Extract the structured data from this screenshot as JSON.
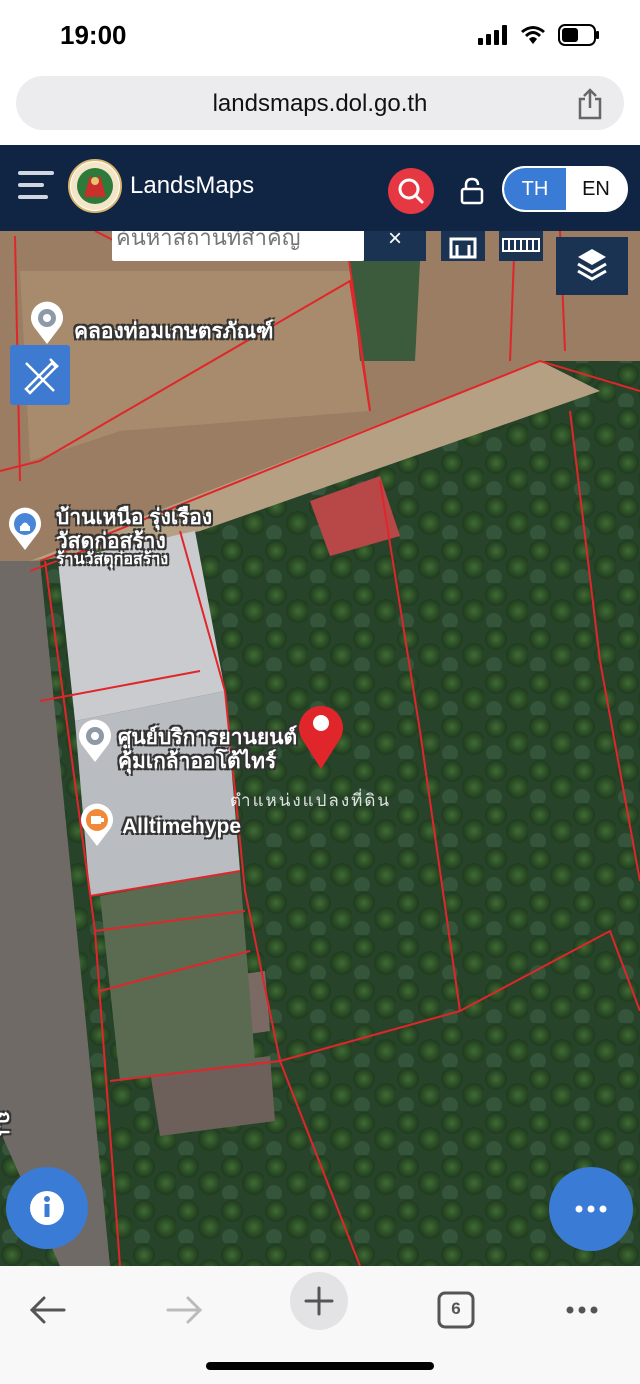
{
  "status_bar": {
    "time": "19:00"
  },
  "browser": {
    "url": "landsmaps.dol.go.th",
    "tab_count": "6"
  },
  "app": {
    "title": "LandsMaps",
    "lang_th": "TH",
    "lang_en": "EN"
  },
  "map": {
    "search_placeholder": "ค้นหาสถานที่สำคัญ",
    "clear_label": "×",
    "labels": {
      "canal": "คลองท่อมเกษตรภัณฑ์",
      "store_line1": "บ้านเหนือ รุ่งเรือง",
      "store_line2": "วัสดุก่อสร้าง",
      "store_line3": "ร้านวัสดุก่อสร้าง",
      "service_line1": "ศูนย์บริการยานยนต์",
      "service_line2": "คุ้มเกล้าออโต้ไทร์",
      "pin_caption": "ตำแหน่งแปลงที่ดิน",
      "alltime": "Alltimehype",
      "road": "ถ.เ"
    }
  },
  "colors": {
    "header": "#102544",
    "accent": "#3a7bd5",
    "search_red": "#e53843",
    "parcel_line": "#e0262a"
  }
}
